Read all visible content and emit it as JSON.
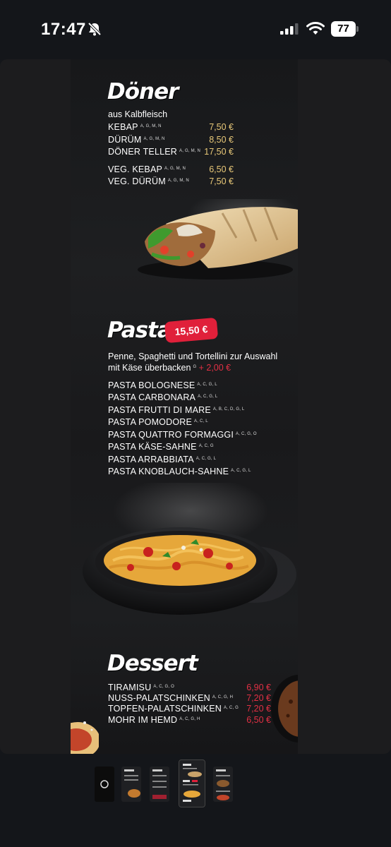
{
  "status_bar": {
    "time": "17:47",
    "battery": "77",
    "icons": [
      "bell-muted-icon",
      "signal-icon",
      "wifi-icon",
      "battery-icon"
    ]
  },
  "menu": {
    "doener": {
      "title": "Döner",
      "subtitle": "aus Kalbfleisch",
      "items": [
        {
          "name": "KEBAP",
          "allergens": "A, G, M, N",
          "price": "7,50 €"
        },
        {
          "name": "DÜRÜM",
          "allergens": "A, G, M, N",
          "price": "8,50 €"
        },
        {
          "name": "DÖNER TELLER",
          "allergens": "A, G, M, N",
          "price": "17,50 €"
        },
        {
          "name": "VEG. KEBAP",
          "allergens": "A, G, M, N",
          "price": "6,50 €"
        },
        {
          "name": "VEG. DÜRÜM",
          "allergens": "A, G, M, N",
          "price": "7,50 €"
        }
      ]
    },
    "pasta": {
      "title": "Pasta",
      "price_badge": "15,50 €",
      "desc_line1": "Penne, Spaghetti und Tortellini zur Auswahl",
      "desc_line2": "mit Käse überbacken",
      "desc_allergen": "G",
      "desc_extra": "+ 2,00 €",
      "items": [
        {
          "name": "PASTA BOLOGNESE",
          "allergens": "A, C, G, L"
        },
        {
          "name": "PASTA CARBONARA",
          "allergens": "A, C, G, L"
        },
        {
          "name": "PASTA FRUTTI DI MARE",
          "allergens": "A, B, C, D, G, L"
        },
        {
          "name": "PASTA POMODORE",
          "allergens": "A, C, L"
        },
        {
          "name": "PASTA QUATTRO FORMAGGI",
          "allergens": "A, C, G, O"
        },
        {
          "name": "PASTA KÄSE-SAHNE",
          "allergens": "A, C, G"
        },
        {
          "name": "PASTA ARRABBIATA",
          "allergens": "A, C, G, L"
        },
        {
          "name": "PASTA KNOBLAUCH-SAHNE",
          "allergens": "A, C, G, L"
        }
      ]
    },
    "dessert": {
      "title": "Dessert",
      "items": [
        {
          "name": "TIRAMISU",
          "allergens": "A, C, G, O",
          "price": "6,90 €"
        },
        {
          "name": "NUSS-PALATSCHINKEN",
          "allergens": "A, C, G, H",
          "price": "7,20 €"
        },
        {
          "name": "TOPFEN-PALATSCHINKEN",
          "allergens": "A, C, G",
          "price": "7,20 €"
        },
        {
          "name": "MOHR IM HEMD",
          "allergens": "A, C, G, H",
          "price": "6,50 €"
        }
      ]
    }
  },
  "thumbnails": {
    "count": 5,
    "active_index": 3
  }
}
